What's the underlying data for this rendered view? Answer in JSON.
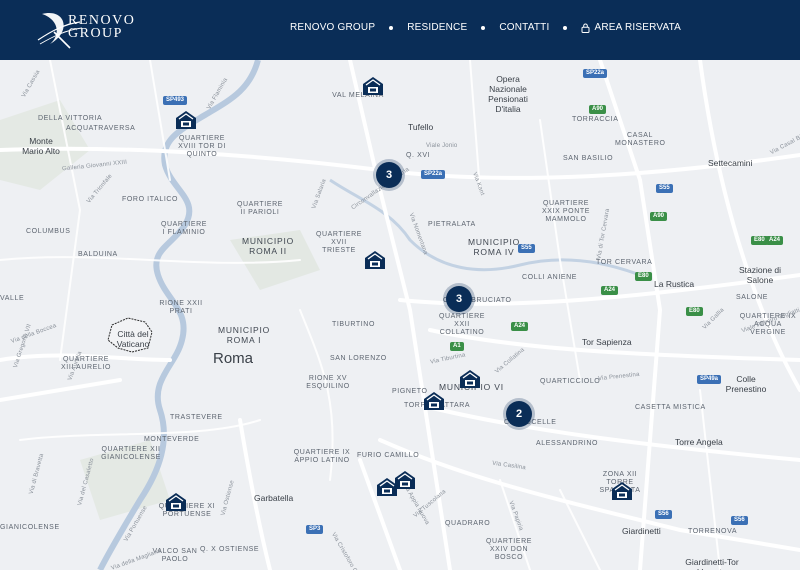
{
  "header": {
    "logo_line1": "RENOVO",
    "logo_line2": "GROUP",
    "nav": [
      {
        "label": "RENOVO GROUP"
      },
      {
        "label": "RESIDENCE"
      },
      {
        "label": "CONTATTI"
      },
      {
        "label": "AREA RISERVATA",
        "icon": "lock-icon"
      }
    ]
  },
  "map": {
    "city_label": "Roma",
    "labels": [
      "VAL MELAINA",
      "DELLA VITTORIA",
      "ACQUATRAVERSA",
      "Monte Mario Alto",
      "QUARTIERE XVIII TOR DI QUINTO",
      "Tufello",
      "Q. XVI",
      "Opera Nazionale Pensionati D'italia",
      "TORRACCIA",
      "CASAL MONASTERO",
      "SAN BASILIO",
      "Settecamini",
      "QUARTIERE II PARIOLI",
      "QUARTIERE I FLAMINIO",
      "FORO ITALICO",
      "COLUMBUS",
      "BALDUINA",
      "MUNICIPIO ROMA II",
      "QUARTIERE XVII TRIESTE",
      "PIETRALATA",
      "QUARTIERE XXIX PONTE MAMMOLO",
      "MUNICIPIO ROMA IV",
      "COLLI ANIENE",
      "TOR CERVARA",
      "Stazione di Salone",
      "La Rustica",
      "SALONE",
      "RIONE XXII PRATI",
      "TIBURTINO",
      "CASAL BRUCIATO",
      "QUARTIERE XXII COLLATINO",
      "QUARTIERE IX ACQUA VERGINE",
      "VALLE",
      "Città del Vaticano",
      "MUNICIPIO ROMA I",
      "Tor Sapienza",
      "QUARTIERE XIII AURELIO",
      "SAN LORENZO",
      "RIONE XV ESQUILINO",
      "PIGNETO",
      "MUNICIPIO VI",
      "TORPIGNATTARA",
      "QUARTICCIOLO",
      "Colle Prenestino",
      "TRASTEVERE",
      "CASETTA MISTICA",
      "CENTOCELLE",
      "ALESSANDRINO",
      "MONTEVERDE",
      "QUARTIERE XII GIANICOLENSE",
      "QUARTIERE IX APPIO LATINO",
      "FURIO CAMILLO",
      "Torre Angela",
      "ZONA XII TORRE SPACCATA",
      "QUARTIERE XI PORTUENSE",
      "Garbatella",
      "GIANICOLENSE",
      "QUADRARO",
      "Giardinetti",
      "TORRENOVA",
      "VALCO SAN PAOLO",
      "Q. X OSTIENSE",
      "QUARTIERE XXIV DON BOSCO",
      "Giardinetti-Tor Vergata"
    ],
    "roads": [
      "SP493",
      "SP22a",
      "SP22a",
      "A90",
      "S55",
      "A90",
      "E80",
      "A24",
      "S55",
      "E80",
      "A24",
      "A24",
      "E80",
      "SP49a",
      "S56",
      "S56",
      "SP3",
      "A1",
      "Viale Jonio",
      "Via Casal Bianco",
      "Via Tiburtina",
      "Via Collatina",
      "Via Prenestina",
      "Via Casilina",
      "Via Flaminia",
      "Via Salaria",
      "Via Appia Nuova",
      "Via Portuense",
      "Galleria Giovanni XXIII",
      "Circonvallazione Salaria",
      "Via Trionfale",
      "Via Aurelia",
      "Via Gregorio VII",
      "Via della Boccea",
      "Via del Casaletto",
      "Via di Bravetta",
      "Viale Palmiro Togliatti",
      "Via Ostiense",
      "Via Tuscolana",
      "Via Cassia",
      "Via Kant",
      "Via Nomentana",
      "Via di Tor Cervara",
      "Via Papiria",
      "Via Cristoforo Colombo",
      "Via della Magliana",
      "Via Gallia"
    ],
    "clusters": [
      {
        "count": "3"
      },
      {
        "count": "3"
      },
      {
        "count": "2"
      }
    ],
    "markers": 9,
    "colors": {
      "header_bg": "#0a2d57",
      "cluster_bg": "#0a2d57",
      "marker_bg": "#0a2d57",
      "water": "#b7c9de",
      "road_shield": "#3b70b5",
      "road_shield_green": "#3a8f47"
    }
  }
}
